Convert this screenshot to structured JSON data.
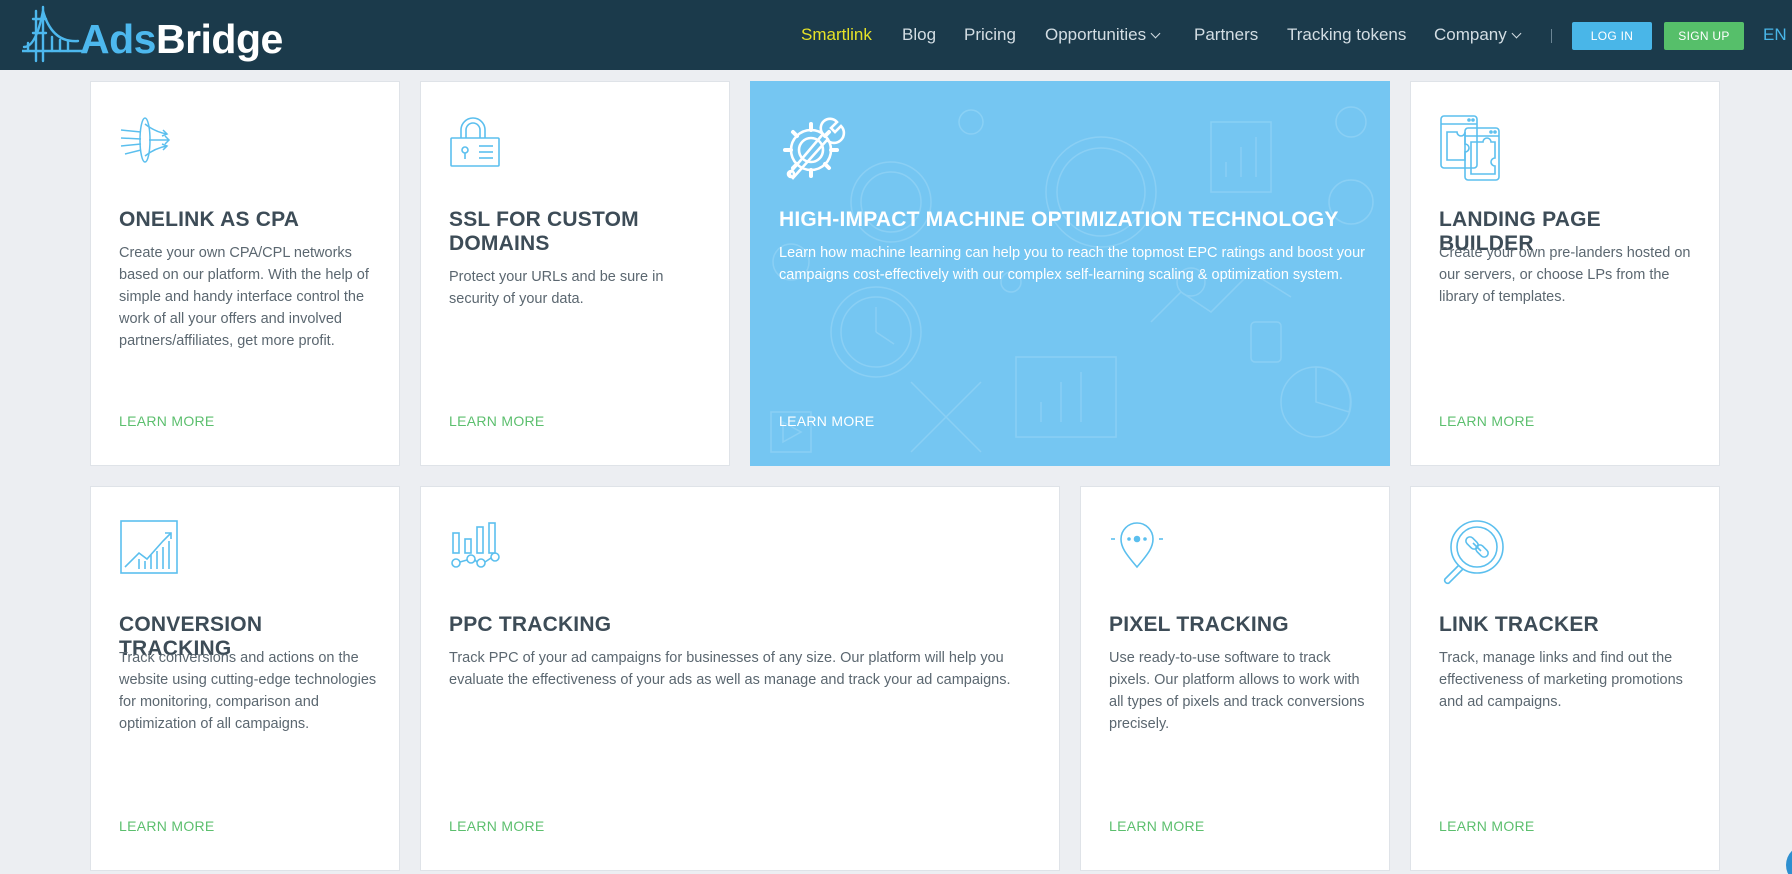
{
  "brand": {
    "ads": "Ads",
    "bridge": "Bridge"
  },
  "nav": {
    "items": [
      {
        "label": "Smartlink",
        "active": true
      },
      {
        "label": "Blog"
      },
      {
        "label": "Pricing"
      },
      {
        "label": "Opportunities",
        "dropdown": true
      },
      {
        "label": "Partners"
      },
      {
        "label": "Tracking tokens"
      },
      {
        "label": "Company",
        "dropdown": true
      }
    ],
    "login": "LOG IN",
    "signup": "SIGN UP",
    "lang": "EN"
  },
  "colors": {
    "header": "#1b3a4b",
    "accent_blue": "#49b6e8",
    "accent_green": "#56bf6a",
    "active_nav": "#e6e227",
    "featured_bg": "#75c6f2"
  },
  "cards": [
    {
      "icon": "network-funnel-icon",
      "title": "ONELINK AS CPA",
      "desc": "Create your own CPA/CPL networks based on our platform. With the help of simple and handy interface control the work of all your offers and involved partners/affiliates, get more profit.",
      "more": "LEARN MORE"
    },
    {
      "icon": "lock-icon",
      "title": "SSL FOR CUSTOM DOMAINS",
      "desc": "Protect your URLs and be sure in security of your data.",
      "more": "LEARN MORE"
    },
    {
      "icon": "gear-wrench-icon",
      "title": "HIGH-IMPACT MACHINE OPTIMIZATION TECHNOLOGY",
      "desc": "Learn how machine learning can help you to reach the topmost EPC ratings and boost your campaigns cost-effectively with our complex self-learning scaling & optimization system.",
      "more": "LEARN MORE"
    },
    {
      "icon": "puzzle-pages-icon",
      "title": "LANDING PAGE BUILDER",
      "desc": "Create your own pre-landers hosted on our servers, or choose LPs from the library of templates.",
      "more": "LEARN MORE"
    },
    {
      "icon": "growth-chart-icon",
      "title": "CONVERSION TRACKING",
      "desc": "Track conversions and actions on the website using cutting-edge technologies for monitoring, comparison and optimization of all campaigns.",
      "more": "LEARN MORE"
    },
    {
      "icon": "bar-analytics-icon",
      "title": "PPC TRACKING",
      "desc": "Track PPC of your ad campaigns for businesses of any size. Our platform will help you evaluate the effectiveness of your ads as well as manage and track your ad campaigns.",
      "more": "LEARN MORE"
    },
    {
      "icon": "location-pin-icon",
      "title": "PIXEL TRACKING",
      "desc": "Use ready-to-use software to track pixels. Our platform allows to work with all types of pixels and track conversions precisely.",
      "more": "LEARN MORE"
    },
    {
      "icon": "magnifier-link-icon",
      "title": "LINK TRACKER",
      "desc": "Track, manage links and find out the effectiveness of marketing promotions and ad campaigns.",
      "more": "LEARN MORE"
    }
  ]
}
